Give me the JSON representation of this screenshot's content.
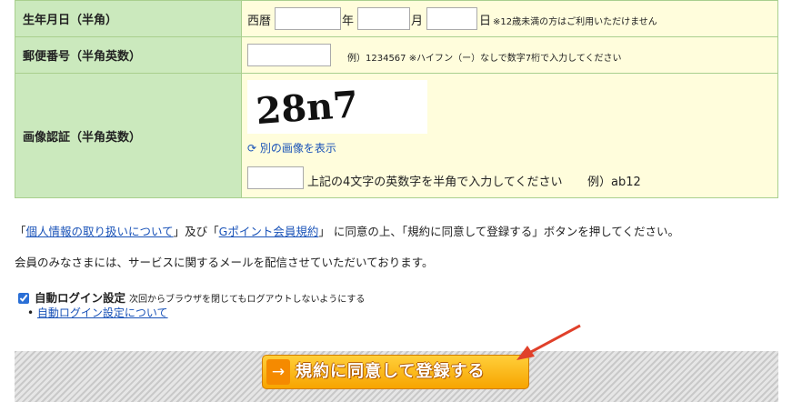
{
  "birthdate": {
    "label": "生年月日（半角）",
    "era": "西暦",
    "year": "年",
    "month": "月",
    "day": "日",
    "note": "※12歳未満の方はご利用いただけません"
  },
  "postal": {
    "label": "郵便番号（半角英数）",
    "note": "例）1234567 ※ハイフン（ー）なしで数字7桁で入力してください"
  },
  "captcha": {
    "label": "画像認証（半角英数）",
    "image_text": "28n7",
    "reload_link": "別の画像を表示",
    "instruction": "上記の4文字の英数字を半角で入力してください",
    "example": "例）ab12"
  },
  "agreement": {
    "prefix": "「",
    "link1": "個人情報の取り扱いについて",
    "mid": "」及び「",
    "link2": "Gポイント会員規約",
    "suffix": "」 に同意の上、「規約に同意して登録する」ボタンを押してください。"
  },
  "notice": "会員のみなさまには、サービスに関するメールを配信させていただいております。",
  "auto_login": {
    "checked": true,
    "label": "自動ログイン設定",
    "description": "次回からブラウザを閉じてもログアウトしないようにする",
    "link": "自動ログイン設定について"
  },
  "submit": {
    "label": "規約に同意して登録する",
    "arrow": "→"
  },
  "colors": {
    "label_bg": "#cbe9bd",
    "value_bg": "#fffddc",
    "border": "#a9cf8e",
    "button": "#f7a400",
    "annotation_arrow": "#e0402a"
  }
}
